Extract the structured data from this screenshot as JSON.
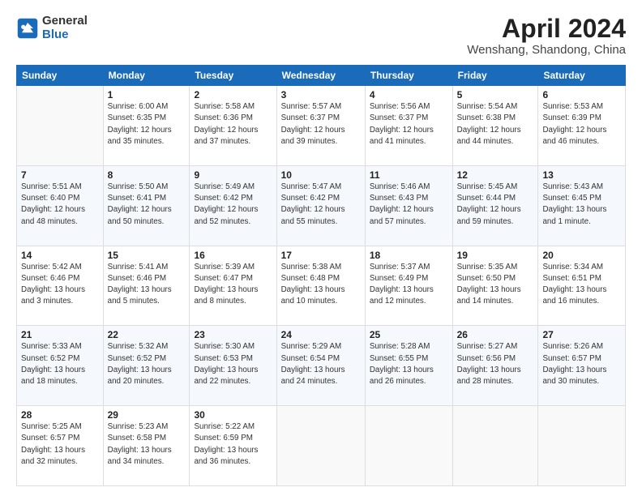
{
  "logo": {
    "text_general": "General",
    "text_blue": "Blue"
  },
  "header": {
    "title": "April 2024",
    "subtitle": "Wenshang, Shandong, China"
  },
  "weekdays": [
    "Sunday",
    "Monday",
    "Tuesday",
    "Wednesday",
    "Thursday",
    "Friday",
    "Saturday"
  ],
  "weeks": [
    [
      {
        "day": "",
        "info": ""
      },
      {
        "day": "1",
        "info": "Sunrise: 6:00 AM\nSunset: 6:35 PM\nDaylight: 12 hours\nand 35 minutes."
      },
      {
        "day": "2",
        "info": "Sunrise: 5:58 AM\nSunset: 6:36 PM\nDaylight: 12 hours\nand 37 minutes."
      },
      {
        "day": "3",
        "info": "Sunrise: 5:57 AM\nSunset: 6:37 PM\nDaylight: 12 hours\nand 39 minutes."
      },
      {
        "day": "4",
        "info": "Sunrise: 5:56 AM\nSunset: 6:37 PM\nDaylight: 12 hours\nand 41 minutes."
      },
      {
        "day": "5",
        "info": "Sunrise: 5:54 AM\nSunset: 6:38 PM\nDaylight: 12 hours\nand 44 minutes."
      },
      {
        "day": "6",
        "info": "Sunrise: 5:53 AM\nSunset: 6:39 PM\nDaylight: 12 hours\nand 46 minutes."
      }
    ],
    [
      {
        "day": "7",
        "info": "Sunrise: 5:51 AM\nSunset: 6:40 PM\nDaylight: 12 hours\nand 48 minutes."
      },
      {
        "day": "8",
        "info": "Sunrise: 5:50 AM\nSunset: 6:41 PM\nDaylight: 12 hours\nand 50 minutes."
      },
      {
        "day": "9",
        "info": "Sunrise: 5:49 AM\nSunset: 6:42 PM\nDaylight: 12 hours\nand 52 minutes."
      },
      {
        "day": "10",
        "info": "Sunrise: 5:47 AM\nSunset: 6:42 PM\nDaylight: 12 hours\nand 55 minutes."
      },
      {
        "day": "11",
        "info": "Sunrise: 5:46 AM\nSunset: 6:43 PM\nDaylight: 12 hours\nand 57 minutes."
      },
      {
        "day": "12",
        "info": "Sunrise: 5:45 AM\nSunset: 6:44 PM\nDaylight: 12 hours\nand 59 minutes."
      },
      {
        "day": "13",
        "info": "Sunrise: 5:43 AM\nSunset: 6:45 PM\nDaylight: 13 hours\nand 1 minute."
      }
    ],
    [
      {
        "day": "14",
        "info": "Sunrise: 5:42 AM\nSunset: 6:46 PM\nDaylight: 13 hours\nand 3 minutes."
      },
      {
        "day": "15",
        "info": "Sunrise: 5:41 AM\nSunset: 6:46 PM\nDaylight: 13 hours\nand 5 minutes."
      },
      {
        "day": "16",
        "info": "Sunrise: 5:39 AM\nSunset: 6:47 PM\nDaylight: 13 hours\nand 8 minutes."
      },
      {
        "day": "17",
        "info": "Sunrise: 5:38 AM\nSunset: 6:48 PM\nDaylight: 13 hours\nand 10 minutes."
      },
      {
        "day": "18",
        "info": "Sunrise: 5:37 AM\nSunset: 6:49 PM\nDaylight: 13 hours\nand 12 minutes."
      },
      {
        "day": "19",
        "info": "Sunrise: 5:35 AM\nSunset: 6:50 PM\nDaylight: 13 hours\nand 14 minutes."
      },
      {
        "day": "20",
        "info": "Sunrise: 5:34 AM\nSunset: 6:51 PM\nDaylight: 13 hours\nand 16 minutes."
      }
    ],
    [
      {
        "day": "21",
        "info": "Sunrise: 5:33 AM\nSunset: 6:52 PM\nDaylight: 13 hours\nand 18 minutes."
      },
      {
        "day": "22",
        "info": "Sunrise: 5:32 AM\nSunset: 6:52 PM\nDaylight: 13 hours\nand 20 minutes."
      },
      {
        "day": "23",
        "info": "Sunrise: 5:30 AM\nSunset: 6:53 PM\nDaylight: 13 hours\nand 22 minutes."
      },
      {
        "day": "24",
        "info": "Sunrise: 5:29 AM\nSunset: 6:54 PM\nDaylight: 13 hours\nand 24 minutes."
      },
      {
        "day": "25",
        "info": "Sunrise: 5:28 AM\nSunset: 6:55 PM\nDaylight: 13 hours\nand 26 minutes."
      },
      {
        "day": "26",
        "info": "Sunrise: 5:27 AM\nSunset: 6:56 PM\nDaylight: 13 hours\nand 28 minutes."
      },
      {
        "day": "27",
        "info": "Sunrise: 5:26 AM\nSunset: 6:57 PM\nDaylight: 13 hours\nand 30 minutes."
      }
    ],
    [
      {
        "day": "28",
        "info": "Sunrise: 5:25 AM\nSunset: 6:57 PM\nDaylight: 13 hours\nand 32 minutes."
      },
      {
        "day": "29",
        "info": "Sunrise: 5:23 AM\nSunset: 6:58 PM\nDaylight: 13 hours\nand 34 minutes."
      },
      {
        "day": "30",
        "info": "Sunrise: 5:22 AM\nSunset: 6:59 PM\nDaylight: 13 hours\nand 36 minutes."
      },
      {
        "day": "",
        "info": ""
      },
      {
        "day": "",
        "info": ""
      },
      {
        "day": "",
        "info": ""
      },
      {
        "day": "",
        "info": ""
      }
    ]
  ]
}
